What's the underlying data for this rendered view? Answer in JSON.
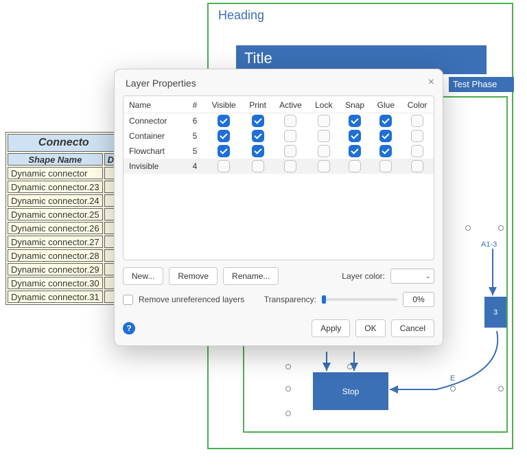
{
  "canvas": {
    "heading": "Heading",
    "title": "Title",
    "test_phase": "Test Phase",
    "stop_label": "Stop",
    "a13_label": "A1-3",
    "box3_label": "3",
    "e_label": "E"
  },
  "sheet": {
    "title": "Connecto",
    "col1": "Shape Name",
    "col2": "Di",
    "rows": [
      "Dynamic connector",
      "Dynamic connector.23",
      "Dynamic connector.24",
      "Dynamic connector.25",
      "Dynamic connector.26",
      "Dynamic connector.27",
      "Dynamic connector.28",
      "Dynamic connector.29",
      "Dynamic connector.30",
      "Dynamic connector.31"
    ]
  },
  "dialog": {
    "title": "Layer Properties",
    "columns": [
      "Name",
      "#",
      "Visible",
      "Print",
      "Active",
      "Lock",
      "Snap",
      "Glue",
      "Color"
    ],
    "layers": [
      {
        "name": "Connector",
        "count": 6,
        "visible": true,
        "print": true,
        "active": false,
        "lock": false,
        "snap": true,
        "glue": true,
        "color": false
      },
      {
        "name": "Container",
        "count": 5,
        "visible": true,
        "print": true,
        "active": false,
        "lock": false,
        "snap": true,
        "glue": true,
        "color": false
      },
      {
        "name": "Flowchart",
        "count": 5,
        "visible": true,
        "print": true,
        "active": false,
        "lock": false,
        "snap": true,
        "glue": true,
        "color": false
      },
      {
        "name": "Invisible",
        "count": 4,
        "visible": false,
        "print": false,
        "active": false,
        "lock": false,
        "snap": false,
        "glue": false,
        "color": false,
        "selected": true
      }
    ],
    "buttons": {
      "new": "New...",
      "remove": "Remove",
      "rename": "Rename..."
    },
    "layer_color_label": "Layer color:",
    "remove_unref_label": "Remove unreferenced layers",
    "transparency_label": "Transparency:",
    "transparency_value": "0%",
    "footer": {
      "apply": "Apply",
      "ok": "OK",
      "cancel": "Cancel"
    }
  }
}
